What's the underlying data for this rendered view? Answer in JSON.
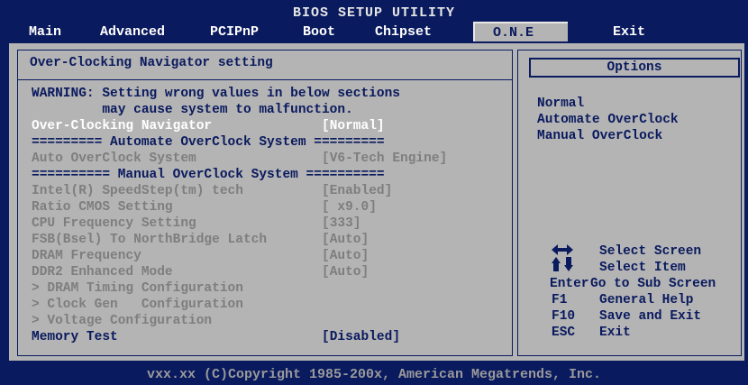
{
  "header": {
    "title": "BIOS SETUP UTILITY",
    "menu": [
      "Main",
      "Advanced",
      "PCIPnP",
      "Boot",
      "Chipset",
      "O.N.E",
      "Exit"
    ],
    "active_index": 5
  },
  "main": {
    "heading": "Over-Clocking Navigator setting",
    "warning_line1": "WARNING: Setting wrong values in below sections",
    "warning_line2": "         may cause system to malfunction.",
    "items": [
      {
        "label": "Over-Clocking Navigator",
        "value": "[Normal]"
      },
      {
        "label": "========= Automate OverClock System ========="
      },
      {
        "label": "Auto OverClock System",
        "value": "[V6-Tech Engine]"
      },
      {
        "label": "========== Manual OverClock System =========="
      },
      {
        "label": "Intel(R) SpeedStep(tm) tech",
        "value": "[Enabled]"
      },
      {
        "label": "Ratio CMOS Setting",
        "value": "[ x9.0]"
      },
      {
        "label": "CPU Frequency Setting",
        "value": "[333]"
      },
      {
        "label": "FSB(Bsel) To NorthBridge Latch",
        "value": "[Auto]"
      },
      {
        "label": "DRAM Frequency",
        "value": "[Auto]"
      },
      {
        "label": "DDR2 Enhanced Mode",
        "value": "[Auto]"
      },
      {
        "label": "> DRAM Timing Configuration"
      },
      {
        "label": "> Clock Gen   Configuration"
      },
      {
        "label": "> Voltage Configuration"
      },
      {
        "label": "Memory Test",
        "value": "[Disabled]"
      }
    ]
  },
  "options": {
    "title": "Options",
    "items": [
      "Normal",
      "Automate OverClock",
      "Manual OverClock"
    ]
  },
  "help": {
    "select_screen": "Select Screen",
    "select_item": "Select Item",
    "enter_key": "Enter",
    "enter_desc": "Go to Sub Screen",
    "f1_key": "F1",
    "f1_desc": "General Help",
    "f10_key": "F10",
    "f10_desc": "Save and Exit",
    "esc_key": "ESC",
    "esc_desc": "Exit"
  },
  "footer": {
    "copyright": "vxx.xx (C)Copyright 1985-200x, American Megatrends, Inc."
  },
  "colors": {
    "background": "#0a1a5e",
    "panel": "#b4b4b4",
    "text": "#0a1a5e",
    "disabled": "#7e7e7e",
    "highlight": "#ffffff"
  }
}
